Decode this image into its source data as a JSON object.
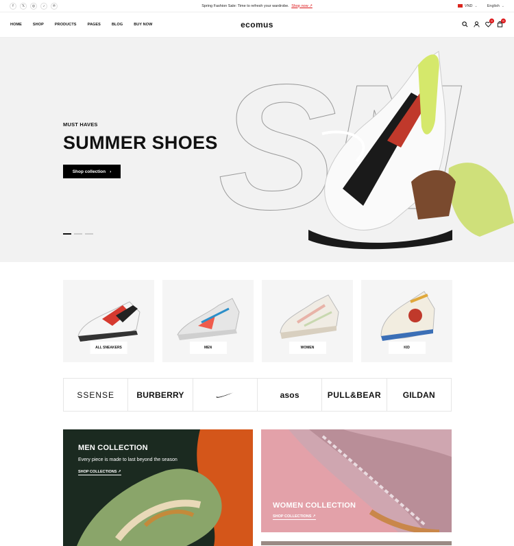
{
  "topbar": {
    "promo_text": "Spring Fashion Sale: Time to refresh your wardrobe.",
    "promo_link": "Shop now ↗",
    "currency": "VND",
    "language": "English",
    "socials": [
      "f",
      "𝕏",
      "◎",
      "♪",
      "℗"
    ]
  },
  "header": {
    "logo": "ecomus",
    "nav": [
      "HOME",
      "SHOP",
      "PRODUCTS",
      "PAGES",
      "BLOG",
      "BUY NOW"
    ],
    "wishlist_count": "0",
    "cart_count": "0"
  },
  "hero": {
    "subtitle": "MUST HAVES",
    "title": "SUMMER SHOES",
    "button": "Shop collection",
    "bg_text": "SN"
  },
  "categories": [
    "ALL SNEAKERS",
    "MEN",
    "WOMEN",
    "KID"
  ],
  "brands": [
    "SSENSE",
    "BURBERRY",
    "",
    "asos",
    "PULL&BEAR",
    "GILDAN"
  ],
  "collections": {
    "men": {
      "title": "MEN COLLECTION",
      "desc": "Every piece is made to last beyond the season",
      "link": "SHOP COLLECTIONS ↗"
    },
    "women": {
      "title": "WOMEN COLLECTION",
      "link": "SHOP COLLECTIONS ↗"
    }
  },
  "colors": {
    "accent": "#db1215",
    "hero_bg": "#f2f2f2"
  }
}
